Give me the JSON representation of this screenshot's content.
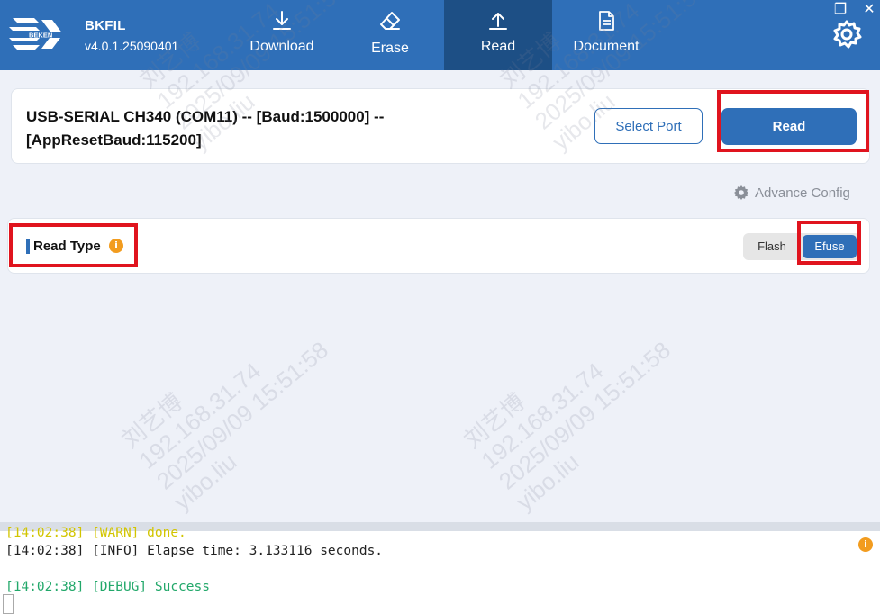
{
  "app": {
    "name": "BKFIL",
    "version": "v4.0.1.25090401",
    "logo_text": "BEKEN"
  },
  "nav": {
    "tabs": [
      {
        "label": "Download",
        "icon": "download-icon"
      },
      {
        "label": "Erase",
        "icon": "eraser-icon"
      },
      {
        "label": "Read",
        "icon": "upload-icon",
        "active": true
      },
      {
        "label": "Document",
        "icon": "document-icon"
      }
    ]
  },
  "window_controls": {
    "restore": "❐",
    "close": "✕"
  },
  "port": {
    "description": "USB-SERIAL CH340 (COM11) -- [Baud:1500000] -- [AppResetBaud:115200]",
    "select_port_label": "Select Port",
    "read_label": "Read"
  },
  "advance_config": {
    "label": "Advance Config"
  },
  "read_type": {
    "label": "Read Type",
    "info_glyph": "i",
    "options": [
      "Flash",
      "Efuse"
    ],
    "selected": "Efuse"
  },
  "log": {
    "lines": [
      {
        "level": "warn",
        "text": "[14:02:38] [WARN] done."
      },
      {
        "level": "info",
        "text": "[14:02:38] [INFO] Elapse time: 3.133116 seconds."
      },
      {
        "level": "debug",
        "text": "[14:02:38] [DEBUG] Success"
      }
    ],
    "info_glyph": "i"
  },
  "watermark": {
    "name": "刘艺博",
    "ip": "192.168.31.74",
    "datetime": "2025/09/09 15:51:58",
    "user": "yibo.liu"
  },
  "colors": {
    "primary": "#2f6fb8",
    "active_tab": "#1d4f85",
    "highlight": "#e0141e",
    "warn": "#d2c500",
    "debug": "#22a86a",
    "info_badge": "#f29c1f"
  }
}
